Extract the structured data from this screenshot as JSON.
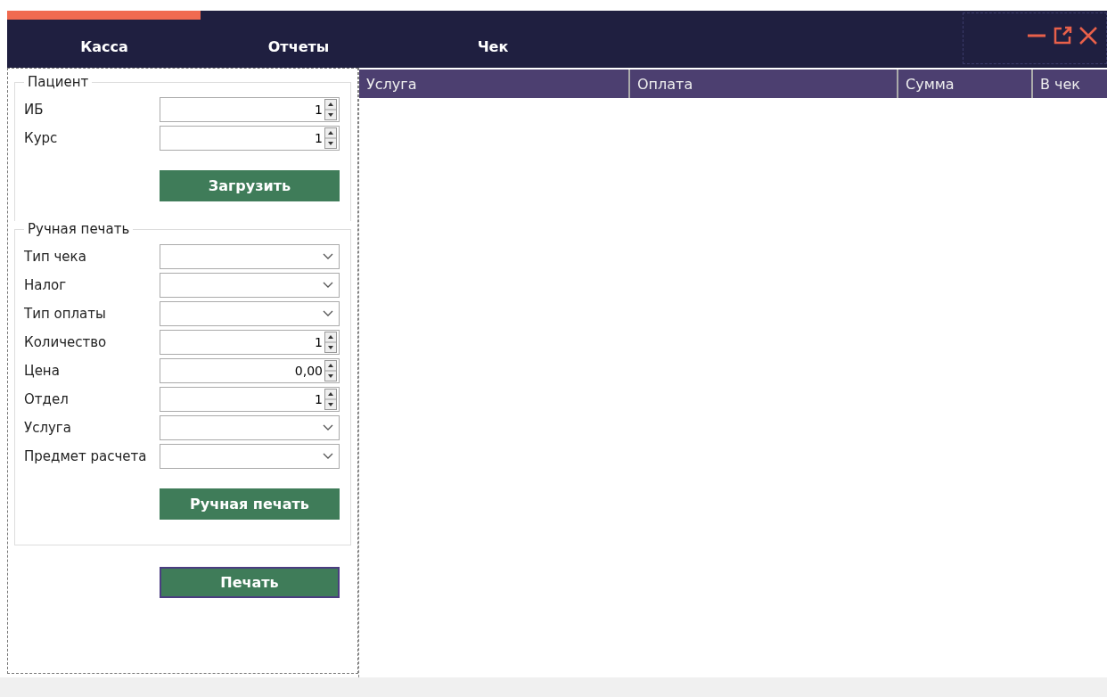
{
  "tabs": [
    {
      "label": "Касса"
    },
    {
      "label": "Отчеты"
    },
    {
      "label": "Чек"
    }
  ],
  "patient": {
    "title": "Пациент",
    "fields": [
      {
        "label": "ИБ",
        "kind": "spin",
        "value": "1"
      },
      {
        "label": "Курс",
        "kind": "spin",
        "value": "1"
      }
    ],
    "button": "Загрузить"
  },
  "manual": {
    "title": "Ручная печать",
    "fields": [
      {
        "label": "Тип чека",
        "kind": "combo"
      },
      {
        "label": "Налог",
        "kind": "combo"
      },
      {
        "label": "Тип оплаты",
        "kind": "combo"
      },
      {
        "label": "Количество",
        "kind": "spin",
        "value": "1"
      },
      {
        "label": "Цена",
        "kind": "spin",
        "value": "0,00"
      },
      {
        "label": "Отдел",
        "kind": "spin",
        "value": "1"
      },
      {
        "label": "Услуга",
        "kind": "combo"
      },
      {
        "label": "Предмет расчета",
        "kind": "combo"
      }
    ],
    "button": "Ручная печать"
  },
  "print_button": "Печать",
  "table": {
    "columns": [
      "Услуга",
      "Оплата",
      "Сумма",
      "В чек"
    ]
  }
}
